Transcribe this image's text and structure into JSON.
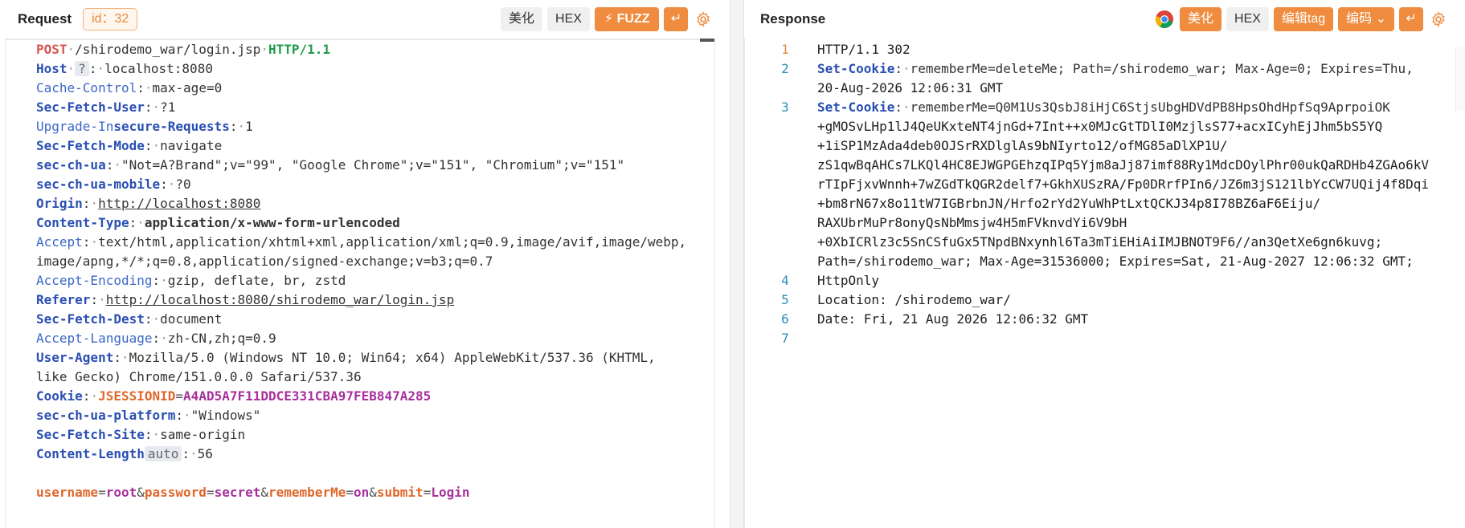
{
  "request": {
    "title": "Request",
    "id_tag": "id：32",
    "buttons": {
      "beautify": "美化",
      "hex": "HEX",
      "fuzz": "FUZZ"
    },
    "lines": [
      {
        "method": "POST",
        "path": "/shirodemo_war/login.jsp",
        "proto": "HTTP/1.1"
      },
      {
        "name": "Host",
        "tag": "?",
        "value": "localhost:8080"
      },
      {
        "name": "Cache-Control",
        "value": "max-age=0"
      },
      {
        "name": "Sec-Fetch-User",
        "value": "?1"
      },
      {
        "name": "Upgrade-Insecure-Requests",
        "value": "1"
      },
      {
        "name": "Sec-Fetch-Mode",
        "value": "navigate"
      },
      {
        "name": "sec-ch-ua",
        "value": "\"Not=A?Brand\";v=\"99\", \"Google Chrome\";v=\"151\", \"Chromium\";v=\"151\""
      },
      {
        "name": "sec-ch-ua-mobile",
        "value": "?0"
      },
      {
        "name": "Origin",
        "value": "http://localhost:8080"
      },
      {
        "name": "Content-Type",
        "value": "application/x-www-form-urlencoded"
      },
      {
        "name": "Accept",
        "value": "text/html,application/xhtml+xml,application/xml;q=0.9,image/avif,image/webp,"
      },
      {
        "cont": "image/apng,*/*;q=0.8,application/signed-exchange;v=b3;q=0.7"
      },
      {
        "name": "Accept-Encoding",
        "value": "gzip, deflate, br, zstd"
      },
      {
        "name": "Referer",
        "value": "http://localhost:8080/shirodemo_war/login.jsp"
      },
      {
        "name": "Sec-Fetch-Dest",
        "value": "document"
      },
      {
        "name": "Accept-Language",
        "value": "zh-CN,zh;q=0.9"
      },
      {
        "name": "User-Agent",
        "value": "Mozilla/5.0 (Windows NT 10.0; Win64; x64) AppleWebKit/537.36 (KHTML, "
      },
      {
        "cont": "like Gecko) Chrome/151.0.0.0 Safari/537.36"
      },
      {
        "name": "Cookie",
        "ck_name": "JSESSIONID",
        "ck_value": "A4AD5A7F11DDCE331CBA97FEB847A285"
      },
      {
        "name": "sec-ch-ua-platform",
        "value": "\"Windows\""
      },
      {
        "name": "Sec-Fetch-Site",
        "value": "same-origin"
      },
      {
        "name": "Content-Length",
        "tag": "auto",
        "value": "56"
      }
    ],
    "body_params": [
      {
        "k": "username",
        "v": "root"
      },
      {
        "k": "password",
        "v": "secret"
      },
      {
        "k": "rememberMe",
        "v": "on"
      },
      {
        "k": "submit",
        "v": "Login"
      }
    ]
  },
  "response": {
    "title": "Response",
    "buttons": {
      "beautify": "美化",
      "hex": "HEX",
      "edit_tag": "编辑tag",
      "encoding": "编码"
    },
    "line_numbers": [
      "1",
      "2",
      "3",
      "4",
      "5",
      "6",
      "7"
    ],
    "status_line": "HTTP/1.1 302",
    "set_cookie_1": {
      "name": "Set-Cookie",
      "value": "rememberMe=deleteMe; Path=/shirodemo_war; Max-Age=0; Expires=Thu,",
      "cont": "20-Aug-2026 12:06:31 GMT"
    },
    "set_cookie_2": {
      "name": "Set-Cookie",
      "value": "rememberMe=Q0M1Us3QsbJ8iHjC6StjsUbgHDVdPB8HpsOhdHpfSq9AprpoiOK",
      "cont": [
        "+gMOSvLHp1lJ4QeUKxteNT4jnGd+7Int++x0MJcGtTDlI0MzjlsS77+acxICyhEjJhm5bS5YQ",
        "+1iSP1MzAda4deb0OJSrRXDlglAs9bNIyrto12/ofMG85aDlXP1U/",
        "zS1qwBqAHCs7LKQl4HC8EJWGPGEhzqIPq5Yjm8aJj87imf88Ry1MdcDOylPhr00ukQaRDHb4ZGAo6kV",
        "rTIpFjxvWnnh+7wZGdTkQGR2delf7+GkhXUSzRA/Fp0DRrfPIn6/JZ6m3jS121lbYcCW7UQij4f8Dqi",
        "+bm8rN67x8o11tW7IGBrbnJN/Hrfo2rYd2YuWhPtLxtQCKJ34p8I78BZ6aF6Eiju/",
        "RAXUbrMuPr8onyQsNbMmsjw4H5mFVknvdYi6V9bH",
        "+0XbICRlz3c5SnCSfuGx5TNpdBNxynhl6Ta3mTiEHiAiIMJBNOT9F6//an3QetXe6gn6kuvg;",
        "Path=/shirodemo_war; Max-Age=31536000; Expires=Sat, 21-Aug-2027 12:06:32 GMT;",
        "HttpOnly"
      ]
    },
    "location": "Location: /shirodemo_war/",
    "date": "Date: Fri, 21 Aug 2026 12:06:32 GMT"
  }
}
